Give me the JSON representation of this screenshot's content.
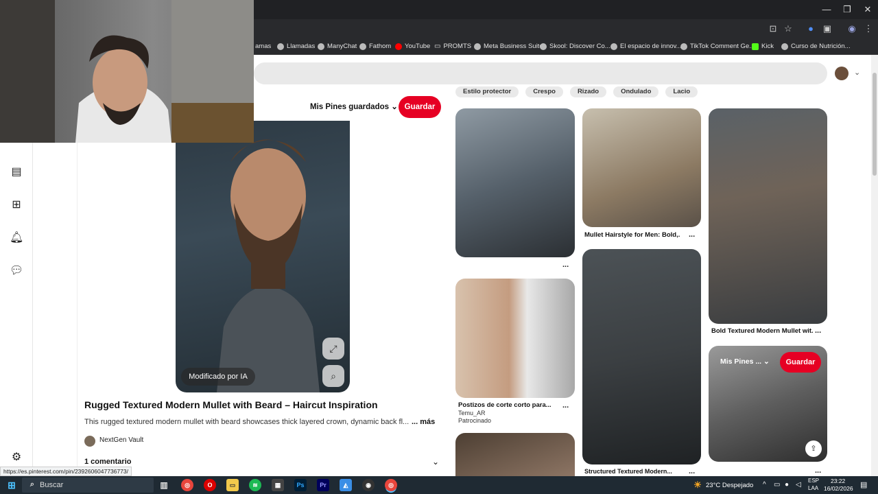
{
  "browser": {
    "bookmarks": [
      "Llamadas",
      "ManyChat",
      "Fathom",
      "YouTube",
      "PROMTS",
      "Meta Business Suite",
      "Skool: Discover Co...",
      "El espacio de innov...",
      "TikTok Comment Ge...",
      "Kick",
      "Curso de Nutrición..."
    ],
    "bookmark_partial": "amas",
    "status_url": "https://es.pinterest.com/pin/2392606047736773/"
  },
  "pin": {
    "board_menu": "Mis Pines guardados",
    "save_label": "Guardar",
    "ai_badge": "Modificado por IA",
    "title": "Rugged Textured Modern Mullet with Beard – Haircut Inspiration",
    "description": "This rugged textured modern mullet with beard showcases thick layered crown, dynamic back fl...",
    "more_label": "... más",
    "creator": "NextGen Vault",
    "comments": "1 comentario"
  },
  "chips": [
    "Estilo protector",
    "Crespo",
    "Rizado",
    "Ondulado",
    "Lacio"
  ],
  "grid": {
    "tile2_caption": "Mullet Hairstyle for Men: Bold,...",
    "tile3_caption": "Bold Textured Modern Mullet wit...",
    "tile5_caption": "Postizos de corte corto para...",
    "tile5_sub1": "Temu_AR",
    "tile5_sub2": "Patrocinado",
    "tile6_caption": "Structured Textured Modern...",
    "hover_menu": "Mis Pines ...",
    "hover_save": "Guardar",
    "more_dots": "..."
  },
  "taskbar": {
    "search_placeholder": "Buscar",
    "weather": "23°C  Despejado",
    "lang1": "ESP",
    "lang2": "LAA",
    "time": "23:22",
    "date": "16/02/2026"
  },
  "colors": {
    "accent": "#e60023",
    "chrome": "#202124",
    "taskbar": "#1f2a33"
  }
}
